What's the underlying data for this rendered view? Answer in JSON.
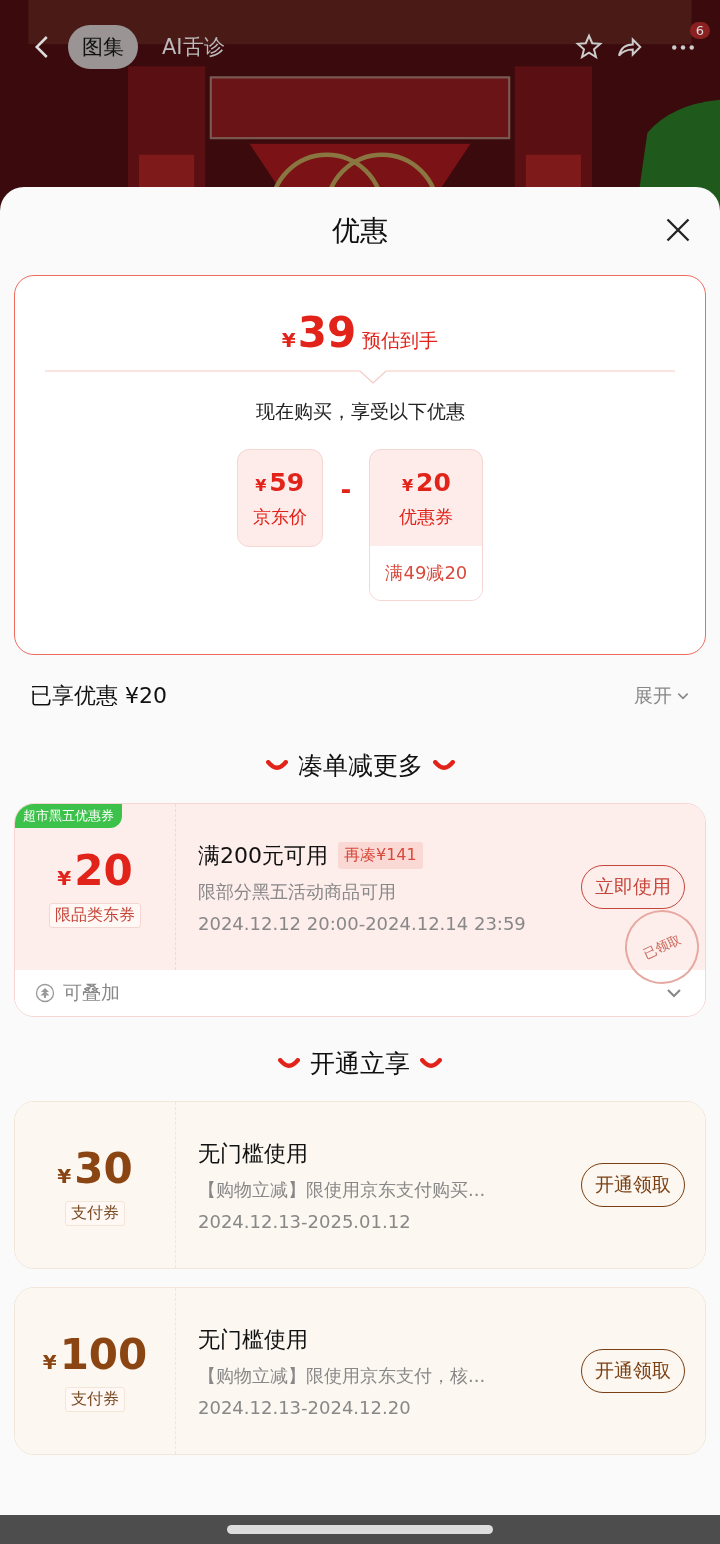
{
  "nav": {
    "tabs": [
      {
        "label": "图集",
        "selected": true
      },
      {
        "label": "AI舌诊",
        "selected": false
      }
    ],
    "badge": "6"
  },
  "sheet": {
    "title": "优惠"
  },
  "estimate": {
    "symbol": "¥",
    "price": "39",
    "label": "预估到手",
    "intro": "现在购买，享受以下优惠",
    "operator": "-",
    "items": [
      {
        "kind": "price",
        "symbol": "¥",
        "amount": "59",
        "label": "京东价"
      },
      {
        "kind": "coupon",
        "symbol": "¥",
        "amount": "20",
        "label": "优惠券",
        "condition": "满49减20"
      }
    ]
  },
  "savings": {
    "label": "已享优惠 ¥20",
    "toggle": "展开"
  },
  "sections": [
    {
      "title": "凑单减更多",
      "coupons": [
        {
          "kind": "red",
          "tag": "超市黑五优惠券",
          "symbol": "¥",
          "amount": "20",
          "type_label": "限品类东券",
          "title": "满200元可用",
          "badge": "再凑¥141",
          "description": "限部分黑五活动商品可用",
          "validity": "2024.12.12 20:00-2024.12.14 23:59",
          "button": "立即使用",
          "stamp": "已领取",
          "footer": "可叠加"
        }
      ]
    },
    {
      "title": "开通立享",
      "coupons": [
        {
          "kind": "gold",
          "symbol": "¥",
          "amount": "30",
          "type_label": "支付券",
          "title": "无门槛使用",
          "description": "【购物立减】限使用京东支付购买...",
          "validity": "2024.12.13-2025.01.12",
          "button": "开通领取"
        },
        {
          "kind": "gold",
          "symbol": "¥",
          "amount": "100",
          "type_label": "支付券",
          "title": "无门槛使用",
          "description": "【购物立减】限使用京东支付，核...",
          "validity": "2024.12.13-2024.12.20",
          "button": "开通领取"
        }
      ]
    }
  ]
}
